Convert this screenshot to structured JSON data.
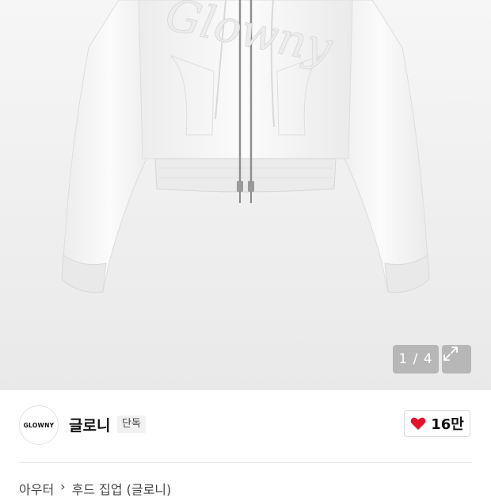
{
  "gallery": {
    "counter": "1 / 4",
    "hoodie_embroidery": "Glowny"
  },
  "brand": {
    "logo_text": "GLOWNY",
    "name": "글로니",
    "badge": "단독"
  },
  "like": {
    "count": "16만",
    "color": "#e6132a"
  },
  "breadcrumb": {
    "category": "아우터",
    "separator": "›",
    "subcategory": "후드 집업 (글로니)"
  }
}
